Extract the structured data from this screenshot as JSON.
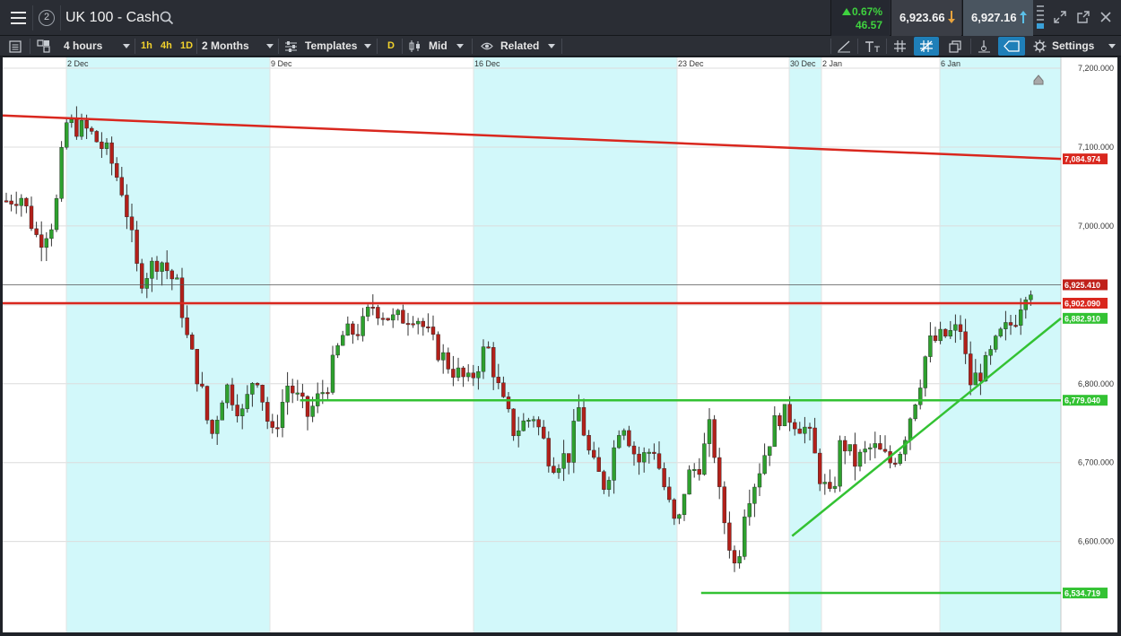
{
  "header": {
    "menu_icon": "hamburger-menu-icon",
    "workspace_count": "2",
    "title": "UK 100 - Cash",
    "search_icon": "search-icon",
    "change_pct": "0.67%",
    "change_abs": "46.57",
    "change_color": "#3fd23f",
    "sell_price": "6,923.66",
    "sell_arrow_color": "#e8a33d",
    "buy_price": "6,927.16",
    "buy_arrow_color": "#5bc0e8",
    "window_icons": [
      "scroll-icon",
      "expand-icon",
      "popout-icon",
      "close-icon"
    ]
  },
  "toolbar": {
    "interval": "4 hours",
    "quick_intervals": [
      "1h",
      "4h",
      "1D"
    ],
    "range": "2 Months",
    "templates": "Templates",
    "d_badge": "D",
    "price_type": "Mid",
    "related": "Related",
    "settings": "Settings",
    "tools": [
      "line-tool-icon",
      "text-tool-icon",
      "grid-icon",
      "crosshair-icon",
      "layers-icon",
      "indicator-icon",
      "tag-icon",
      "settings-gear-icon"
    ]
  },
  "chart_data": {
    "type": "candlestick",
    "instrument": "UK 100 - Cash",
    "interval": "4 hours",
    "x_labels": [
      "2 Dec",
      "9 Dec",
      "16 Dec",
      "23 Dec",
      "30 Dec",
      "2 Jan",
      "6 Jan"
    ],
    "y_ticks": [
      "7,200.000",
      "7,100.000",
      "7,000.000",
      "6,800.000",
      "6,700.000",
      "6,600.000"
    ],
    "ylim": [
      6520,
      7200
    ],
    "price_labels": [
      {
        "text": "7,084.974",
        "value": 7084.974,
        "color": "#d9271e"
      },
      {
        "text": "6,925.410",
        "value": 6925.41,
        "color": "#c0201a"
      },
      {
        "text": "6,902.090",
        "value": 6902.09,
        "color": "#d9271e"
      },
      {
        "text": "6,882.910",
        "value": 6882.91,
        "color": "#33c233"
      },
      {
        "text": "6,779.040",
        "value": 6779.04,
        "color": "#33c233"
      },
      {
        "text": "6,534.719",
        "value": 6534.719,
        "color": "#33c233"
      }
    ],
    "trendlines": [
      {
        "name": "resistance-trendline",
        "color": "#d9271e",
        "from": [
          0,
          7140
        ],
        "to": [
          1,
          7084.974
        ]
      },
      {
        "name": "support-trendline",
        "color": "#33c233",
        "from": [
          0.746,
          6607
        ],
        "to": [
          1,
          6882.91
        ]
      }
    ],
    "horizontal_lines": [
      {
        "name": "resistance-line",
        "value": 6902.09,
        "color": "#d9271e",
        "from": 0,
        "to": 1
      },
      {
        "name": "support-line",
        "value": 6779.04,
        "color": "#33c233",
        "from": 0.281,
        "to": 1
      },
      {
        "name": "low-line",
        "value": 6534.719,
        "color": "#33c233",
        "from": 0.66,
        "to": 1
      }
    ],
    "last_price": 6925.41,
    "up_color": "#2ea02e",
    "down_color": "#b2201a"
  }
}
